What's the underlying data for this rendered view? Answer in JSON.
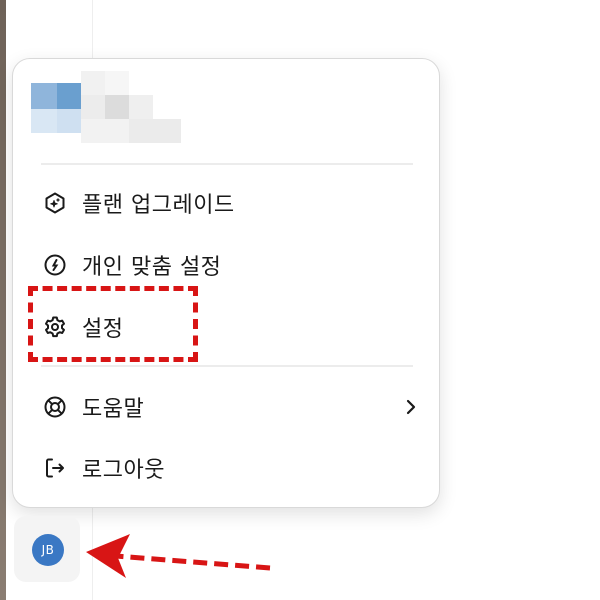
{
  "menu": {
    "items_top": [
      {
        "label": "플랜 업그레이드",
        "icon": "sparkle-hexagon-icon"
      },
      {
        "label": "개인 맞춤 설정",
        "icon": "personalization-icon"
      },
      {
        "label": "설정",
        "icon": "gear-icon"
      }
    ],
    "items_bottom": [
      {
        "label": "도움말",
        "icon": "lifebuoy-icon",
        "has_submenu": true
      },
      {
        "label": "로그아웃",
        "icon": "logout-icon"
      }
    ]
  },
  "profile": {
    "initials": "JB",
    "avatar_color": "#3a78c4"
  },
  "annotation": {
    "color": "#d81515"
  }
}
